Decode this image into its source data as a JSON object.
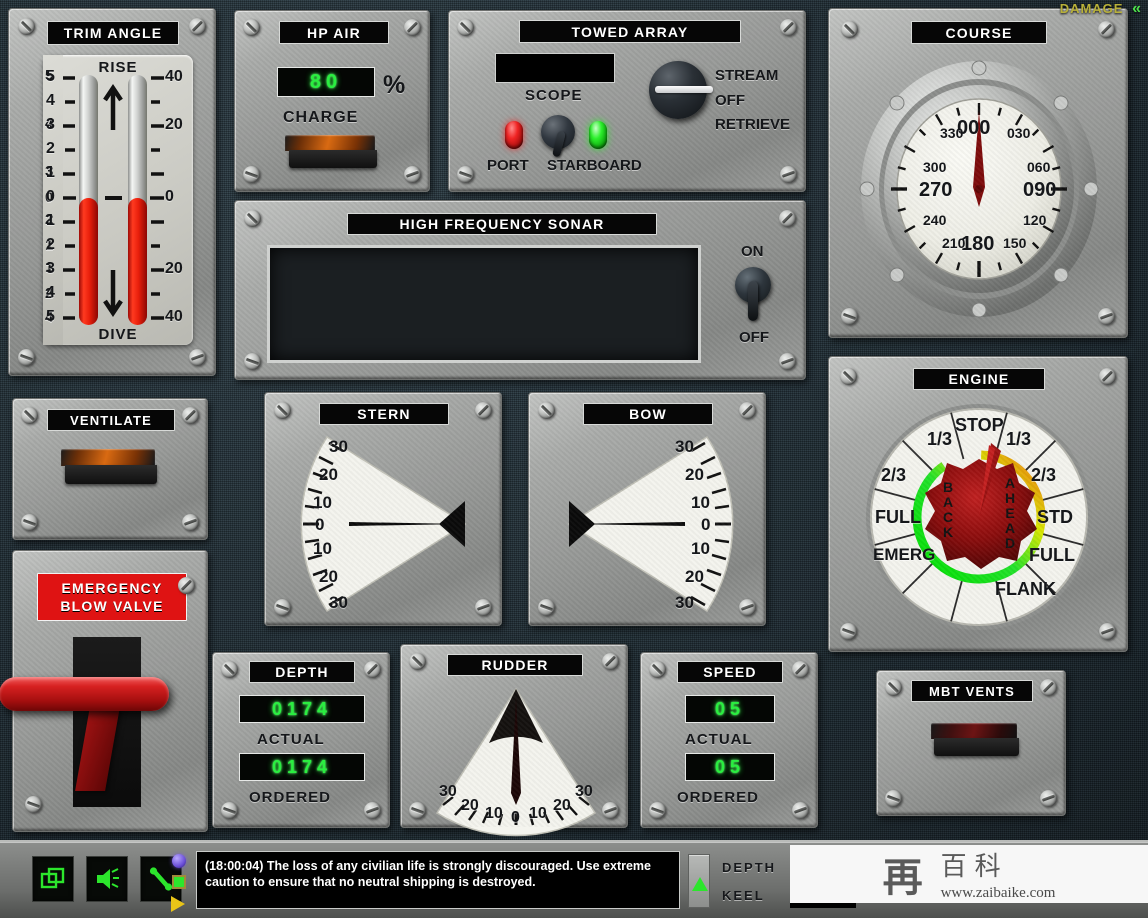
{
  "hud": {
    "damage_label": "DAMAGE",
    "damage_chevron": "«"
  },
  "panels": {
    "trim_angle": {
      "title": "TRIM ANGLE",
      "top_label": "RISE",
      "bottom_label": "DIVE",
      "left_scale": [
        "5",
        "4",
        "3",
        "2",
        "1",
        "0",
        "1",
        "2",
        "3",
        "4",
        "5"
      ],
      "right_scale": [
        "40",
        "20",
        "0",
        "20",
        "40"
      ],
      "left_fill_from": "0",
      "left_fill_to": "5",
      "right_fill_from": "0",
      "right_fill_to": "40",
      "fill_color": "#ee2a14"
    },
    "hp_air": {
      "title": "HP AIR",
      "value": "80",
      "unit": "%",
      "charge_label": "CHARGE",
      "charge_switch_state": "on",
      "value_color": "#2aee40"
    },
    "towed_array": {
      "title": "TOWED ARRAY",
      "scope_label": "SCOPE",
      "scope_value": "",
      "port_label": "PORT",
      "starboard_label": "STARBOARD",
      "port_led_color": "#ef1d1d",
      "starboard_led_color": "#2cf02c",
      "knob_options": [
        "STREAM",
        "OFF",
        "RETRIEVE"
      ],
      "knob_selected": "OFF"
    },
    "course": {
      "title": "COURSE",
      "ticks": [
        "000",
        "030",
        "060",
        "090",
        "120",
        "150",
        "180",
        "210",
        "240",
        "270",
        "300",
        "330"
      ],
      "major": [
        "000",
        "090",
        "180",
        "270"
      ],
      "heading": 0,
      "needle_color": "#8b0a0a"
    },
    "hf_sonar": {
      "title": "HIGH FREQUENCY SONAR",
      "display_value": "",
      "switch_on_label": "ON",
      "switch_off_label": "OFF",
      "switch_state": "OFF"
    },
    "engine": {
      "title": "ENGINE",
      "top_label": "STOP",
      "ahead_labels": [
        "1/3",
        "2/3",
        "STD",
        "FULL",
        "FLANK"
      ],
      "back_labels": [
        "1/3",
        "2/3",
        "FULL",
        "EMERG"
      ],
      "inner_back": "BACK",
      "inner_ahead": "AHEAD",
      "ordered": "1/3",
      "needle_color": "#8e1010"
    },
    "ventilate": {
      "title": "VENTILATE",
      "switch_state": "on"
    },
    "emergency_blow": {
      "title_line1": "EMERGENCY",
      "title_line2": "BLOW VALVE",
      "lever_color": "#cf1f1f"
    },
    "stern": {
      "title": "STERN",
      "scale": [
        "30",
        "20",
        "10",
        "0",
        "10",
        "20",
        "30"
      ],
      "value": "0"
    },
    "bow": {
      "title": "BOW",
      "scale": [
        "30",
        "20",
        "10",
        "0",
        "10",
        "20",
        "30"
      ],
      "value": "0"
    },
    "depth": {
      "title": "DEPTH",
      "actual_value": "0174",
      "actual_label": "ACTUAL",
      "ordered_value": "0174",
      "ordered_label": "ORDERED"
    },
    "rudder": {
      "title": "RUDDER",
      "scale": [
        "30",
        "20",
        "10",
        "0",
        "10",
        "20",
        "30"
      ],
      "value": "0"
    },
    "speed": {
      "title": "SPEED",
      "actual_value": "05",
      "actual_label": "ACTUAL",
      "ordered_value": "05",
      "ordered_label": "ORDERED"
    },
    "mbt_vents": {
      "title": "MBT VENTS",
      "switch_state": "off"
    }
  },
  "statusbar": {
    "icons": [
      "windows-icon",
      "hail-icon",
      "repair-icon"
    ],
    "indicators": [
      "purple-dot",
      "green-square",
      "yellow-triangle"
    ],
    "message": "(18:00:04) The loss of any civilian life is strongly discouraged. Use extreme caution to ensure that no neutral shipping is destroyed.",
    "depth_label": "DEPTH",
    "keel_label": "KEEL",
    "depth_value": "",
    "keel_value": ""
  },
  "watermark": {
    "logo_cn": "再",
    "text_cn": "百科",
    "url": "www.zaibaike.com"
  }
}
